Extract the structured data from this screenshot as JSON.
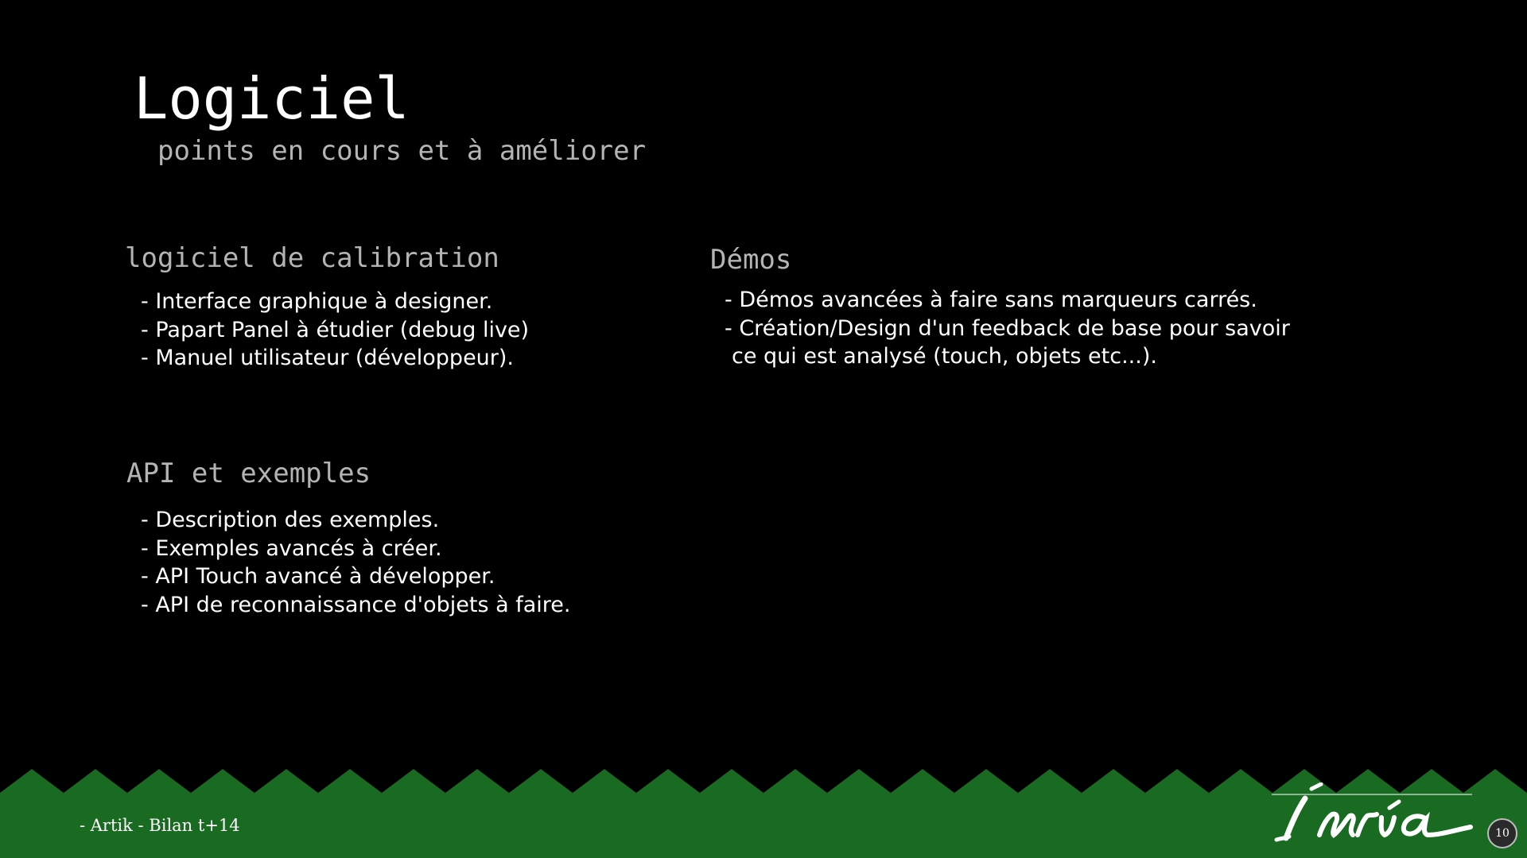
{
  "slide": {
    "title": "Logiciel",
    "subtitle": "points en cours et à améliorer"
  },
  "sections": {
    "calibration": {
      "heading": "logiciel de calibration",
      "items": [
        "- Interface graphique à designer.",
        "- Papart Panel à étudier (debug live)",
        "- Manuel utilisateur (développeur)."
      ]
    },
    "api": {
      "heading": "API et exemples",
      "items": [
        "- Description des exemples.",
        "- Exemples avancés à créer.",
        "- API Touch avancé à développer.",
        "- API de reconnaissance d'objets à faire."
      ]
    },
    "demos": {
      "heading": "Démos",
      "items": [
        "- Démos avancées à faire sans marqueurs carrés.",
        "- Création/Design d'un feedback de base pour savoir",
        "ce qui est analysé (touch, objets etc...)."
      ]
    }
  },
  "footer": {
    "text": "- Artik - Bilan t+14",
    "logo": "Inria",
    "page_number": "10"
  },
  "colors": {
    "background": "#000000",
    "footer_green": "#1a6b22",
    "heading_gray": "#b4b4b4",
    "text": "#ffffff"
  }
}
